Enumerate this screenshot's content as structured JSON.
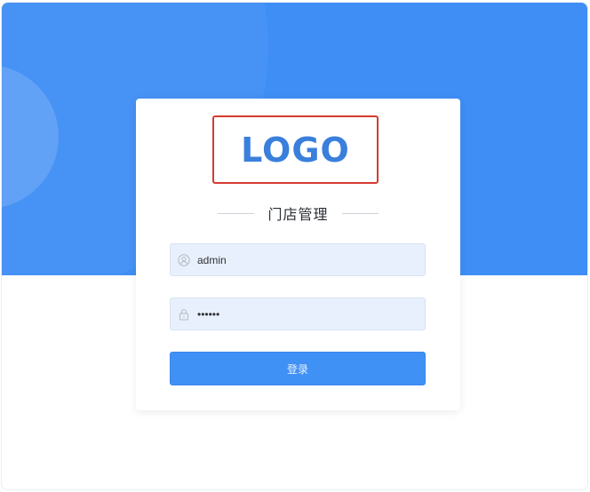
{
  "logo": {
    "text": "LOGO"
  },
  "title": "门店管理",
  "username": {
    "value": "admin",
    "icon": "user-icon"
  },
  "password": {
    "value": "••••••",
    "icon": "lock-icon"
  },
  "login_button": {
    "label": "登录"
  },
  "colors": {
    "banner": "#3f8ef5",
    "logo_text": "#3a7fdc",
    "logo_border": "#d63b2f",
    "input_bg": "#e8f0fd",
    "button": "#4091f6"
  }
}
